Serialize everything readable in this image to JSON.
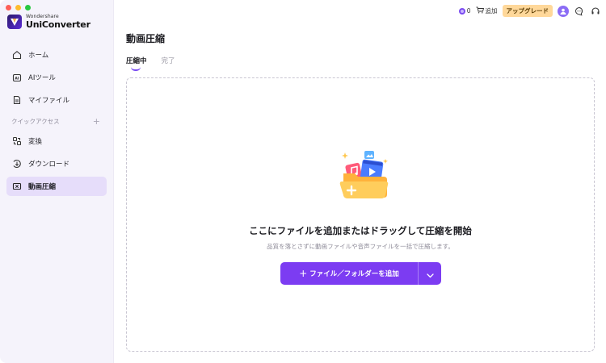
{
  "window": {
    "traffic_lights": [
      "close",
      "minimize",
      "zoom"
    ]
  },
  "brand": {
    "small": "Wondershare",
    "name": "UniConverter"
  },
  "sidebar": {
    "items": [
      {
        "label": "ホーム",
        "icon": "home-icon"
      },
      {
        "label": "AIツール",
        "icon": "ai-tools-icon"
      },
      {
        "label": "マイファイル",
        "icon": "my-files-icon"
      }
    ],
    "quick_access_label": "クイックアクセス",
    "quick_items": [
      {
        "label": "変換",
        "icon": "convert-icon"
      },
      {
        "label": "ダウンロード",
        "icon": "download-icon"
      },
      {
        "label": "動画圧縮",
        "icon": "compress-icon",
        "active": true
      }
    ]
  },
  "topbar": {
    "coins": "0",
    "cart_label": "追加",
    "upgrade_label": "アップグレード"
  },
  "main": {
    "title": "動画圧縮",
    "tabs": [
      {
        "label": "圧縮中",
        "active": true
      },
      {
        "label": "完了",
        "active": false
      }
    ],
    "dropzone": {
      "title": "ここにファイルを追加またはドラッグして圧縮を開始",
      "subtitle": "品質を落とさずに動画ファイルや音声ファイルを一括で圧縮します。",
      "add_button_label": "ファイル／フォルダーを追加"
    }
  },
  "colors": {
    "accent": "#7c3cf2",
    "sidebar_bg": "#f5f3fb",
    "active_item_bg": "#e6ddfa",
    "upgrade_bg": "#ffd89a"
  }
}
